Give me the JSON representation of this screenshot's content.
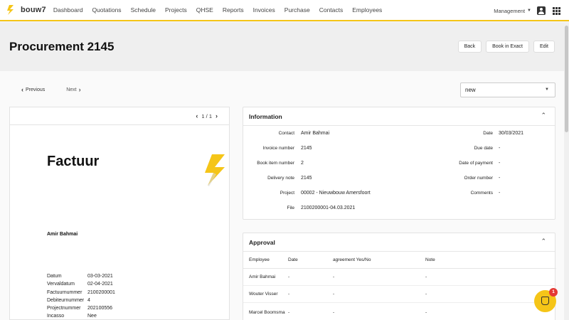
{
  "app": {
    "logo_text": "bouw7"
  },
  "nav": {
    "items": [
      {
        "label": "Dashboard"
      },
      {
        "label": "Quotations"
      },
      {
        "label": "Schedule"
      },
      {
        "label": "Projects"
      },
      {
        "label": "QHSE"
      },
      {
        "label": "Reports"
      },
      {
        "label": "Invoices"
      },
      {
        "label": "Purchase"
      },
      {
        "label": "Contacts"
      },
      {
        "label": "Employees"
      }
    ],
    "company_menu": "Management"
  },
  "header": {
    "title": "Procurement 2145",
    "buttons": {
      "back": "Back",
      "book": "Book in Exact",
      "edit": "Edit"
    }
  },
  "pager": {
    "previous": "Previous",
    "next": "Next"
  },
  "status_select": {
    "value": "new"
  },
  "document": {
    "page_indicator": "1 / 1",
    "heading": "Factuur",
    "recipient": "Amir Bahmai",
    "fields": [
      {
        "key": "Datum",
        "value": "03-03-2021"
      },
      {
        "key": "Vervaldatum",
        "value": "02-04-2021"
      },
      {
        "key": "Factuurnummer",
        "value": "2100200001"
      },
      {
        "key": "Debiteurnummer",
        "value": "4"
      },
      {
        "key": "Projectnummer",
        "value": "202100556"
      },
      {
        "key": "Incasso",
        "value": "Nee"
      }
    ]
  },
  "information": {
    "title": "Information",
    "left": [
      {
        "label": "Contact",
        "value": "Amir Bahmai"
      },
      {
        "label": "Invoice number",
        "value": "2145"
      },
      {
        "label": "Book item number",
        "value": "2"
      },
      {
        "label": "Delivery note",
        "value": "2145"
      },
      {
        "label": "Project",
        "value": "00002 - Nieuwbouw Amersfoort"
      },
      {
        "label": "File",
        "value": "2100200001-04.03.2021"
      }
    ],
    "right": [
      {
        "label": "Date",
        "value": "30/03/2021"
      },
      {
        "label": "Due date",
        "value": "-"
      },
      {
        "label": "Date of payment",
        "value": "-"
      },
      {
        "label": "Order number",
        "value": "-"
      },
      {
        "label": "Comments",
        "value": "-"
      }
    ]
  },
  "approval": {
    "title": "Approval",
    "columns": [
      "Employee",
      "Date",
      "agreement Yes/No",
      "Note"
    ],
    "rows": [
      {
        "employee": "Amir Bahmai",
        "date": "-",
        "agreement": "-",
        "note": "-"
      },
      {
        "employee": "Wouter Visser",
        "date": "-",
        "agreement": "-",
        "note": "-"
      },
      {
        "employee": "Marcel Boomsma",
        "date": "-",
        "agreement": "-",
        "note": "-"
      }
    ]
  },
  "chat": {
    "badge_count": "1"
  },
  "colors": {
    "brand": "#f5c518",
    "badge": "#e53935"
  },
  "icons": [
    "bouw7-logo-icon",
    "user-icon",
    "apps-grid-icon",
    "chevron-left-icon",
    "chevron-right-icon",
    "chevron-down-icon",
    "chevron-up-icon",
    "chat-icon"
  ]
}
